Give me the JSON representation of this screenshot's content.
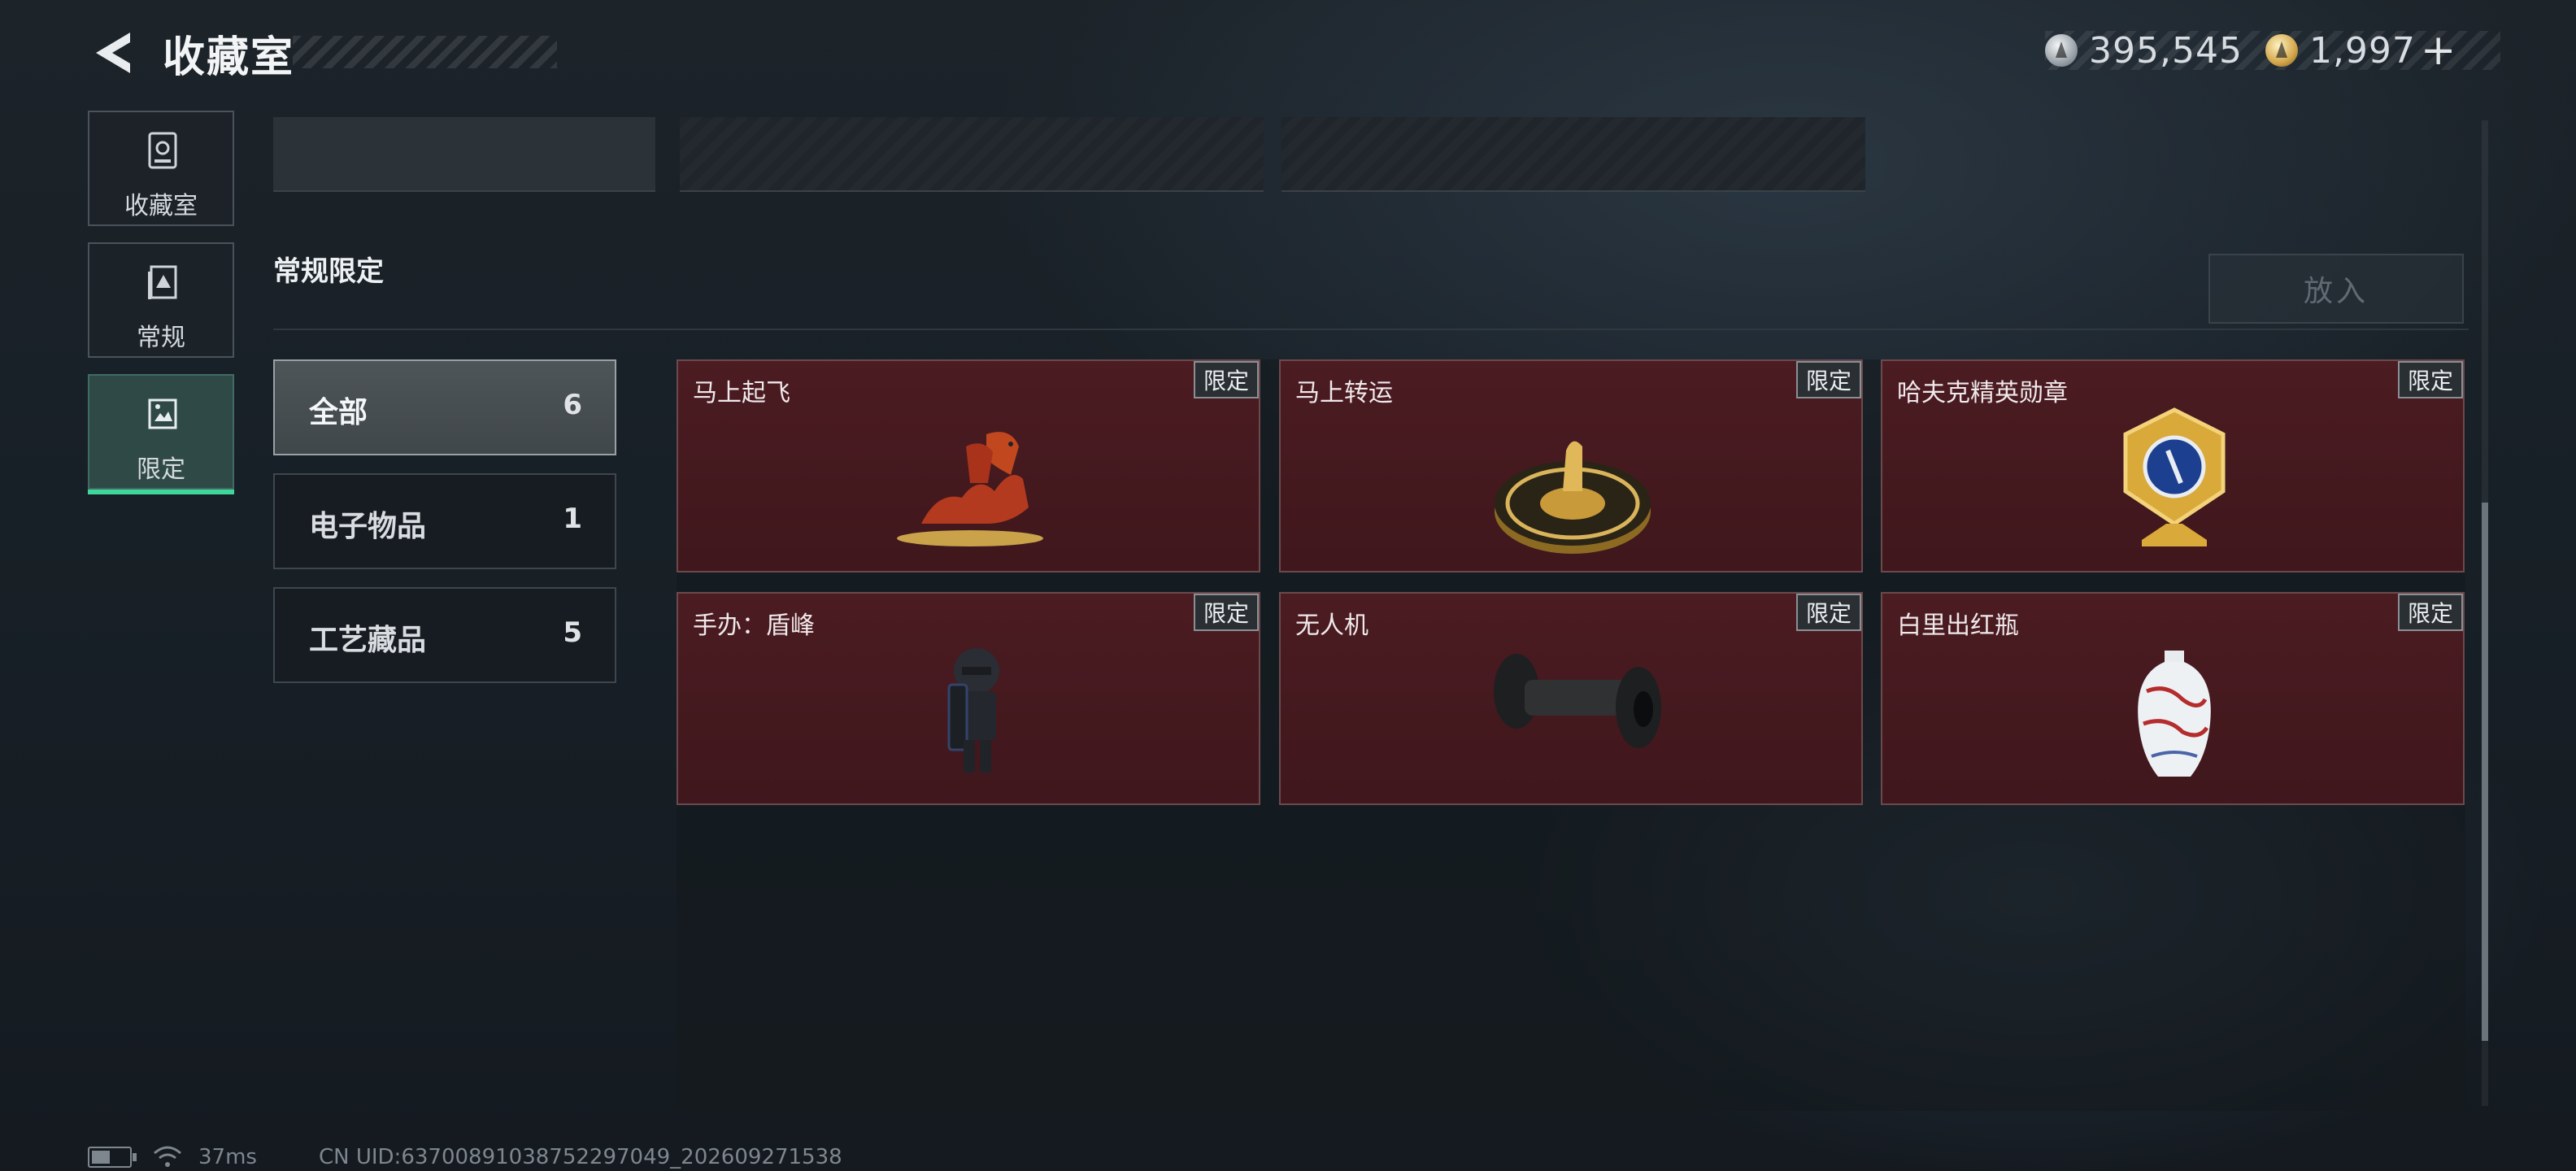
{
  "header": {
    "title": "收藏室",
    "currency": [
      {
        "icon": "silver-coin-icon",
        "value": "395,545"
      },
      {
        "icon": "gold-coin-icon",
        "value": "1,997"
      }
    ],
    "add_label": "+"
  },
  "leftnav": {
    "items": [
      {
        "label": "收藏室",
        "icon": "collection-room-icon",
        "active": false
      },
      {
        "label": "常规",
        "icon": "regular-icon",
        "active": false
      },
      {
        "label": "限定",
        "icon": "limited-icon",
        "active": true
      }
    ]
  },
  "section": {
    "title": "常规限定",
    "place_button": "放入"
  },
  "categories": [
    {
      "name": "全部",
      "count": "6",
      "active": true
    },
    {
      "name": "电子物品",
      "count": "1",
      "active": false
    },
    {
      "name": "工艺藏品",
      "count": "5",
      "active": false
    }
  ],
  "items": [
    {
      "name": "马上起飞",
      "badge": "限定",
      "icon": "red-horse-icon"
    },
    {
      "name": "马上转运",
      "badge": "限定",
      "icon": "gold-compass-horse-icon"
    },
    {
      "name": "哈夫克精英勋章",
      "badge": "限定",
      "icon": "gold-medal-icon"
    },
    {
      "name": "手办：盾峰",
      "badge": "限定",
      "icon": "shield-figure-icon"
    },
    {
      "name": "无人机",
      "badge": "限定",
      "icon": "drone-wheels-icon"
    },
    {
      "name": "白里出红瓶",
      "badge": "限定",
      "icon": "porcelain-vase-icon"
    }
  ],
  "footer": {
    "ping": "37ms",
    "uid": "CN UID:637008910387522970​49_202609271538"
  },
  "colors": {
    "accent": "#3fd69a",
    "item_bg": "#4b1c22",
    "background": "#1a2127"
  }
}
